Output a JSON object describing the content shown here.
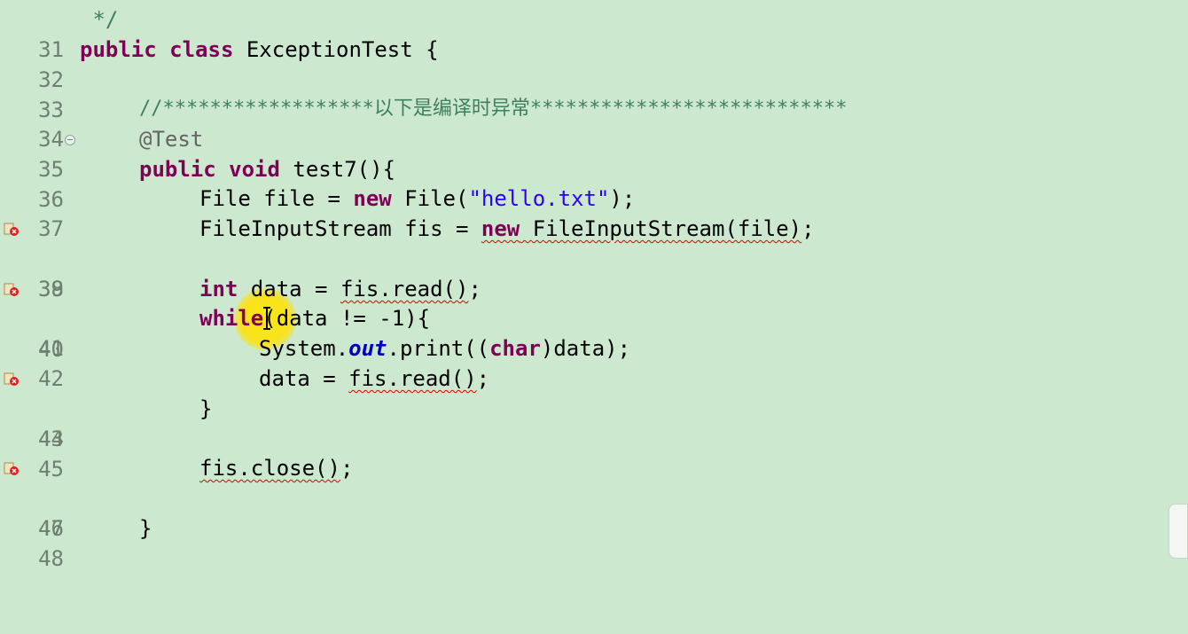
{
  "editor": {
    "lines": [
      {
        "n": "31",
        "code": " */"
      },
      {
        "n": "32",
        "code": "public class ExceptionTest {"
      },
      {
        "n": "33",
        "code": ""
      },
      {
        "n": "34",
        "code": "    //******************以下是编译时异常***************************"
      },
      {
        "n": "35",
        "code": "    @Test"
      },
      {
        "n": "36",
        "code": "    public void test7(){"
      },
      {
        "n": "37",
        "code": "        File file = new File(\"hello.txt\");"
      },
      {
        "n": "38",
        "code": "        FileInputStream fis = new FileInputStream(file);"
      },
      {
        "n": "39",
        "code": ""
      },
      {
        "n": "40",
        "code": "        int data = fis.read();"
      },
      {
        "n": "41",
        "code": "        while(data != -1){"
      },
      {
        "n": "42",
        "code": "            System.out.print((char)data);"
      },
      {
        "n": "43",
        "code": "            data = fis.read();"
      },
      {
        "n": "44",
        "code": "        }"
      },
      {
        "n": "45",
        "code": ""
      },
      {
        "n": "46",
        "code": "        fis.close();"
      },
      {
        "n": "47",
        "code": ""
      },
      {
        "n": "48",
        "code": "    }"
      }
    ],
    "error_lines": [
      "38",
      "40",
      "43",
      "46"
    ],
    "fold_line": "35"
  },
  "tokens": {
    "l31": " */",
    "public": "public",
    "class": "class",
    "classname": " ExceptionTest {",
    "comment34": "//******************以下是编译时异常***************************",
    "ann35": "@Test",
    "l36_public": "public",
    "l36_void": "void",
    "l36_rest": " test7(){",
    "l37_a": "File file = ",
    "l37_new": "new",
    "l37_b": " File(",
    "l37_str": "\"hello.txt\"",
    "l37_c": ");",
    "l38_a": "FileInputStream fis = ",
    "l38_new": "new",
    "l38_err": " FileInputStream(file)",
    "l38_c": ";",
    "l40_int": "int",
    "l40_a": " data = ",
    "l40_err": "fis.read()",
    "l40_c": ";",
    "l41_while": "while",
    "l41_rest": "(data != -1){",
    "l42_a": "System.",
    "l42_out": "out",
    "l42_b": ".print((",
    "l42_char": "char",
    "l42_c": ")data);",
    "l43_a": "data = ",
    "l43_err": "fis.read()",
    "l43_c": ";",
    "l44": "}",
    "l46_err": "fis.close()",
    "l46_c": ";",
    "l48": "}"
  },
  "colors": {
    "background": "#cce8cf",
    "keyword": "#7f0055",
    "comment": "#3f7f5f",
    "string": "#2a00ff",
    "annotation": "#646464",
    "static_field": "#0000c0",
    "error_underline": "#e00000",
    "line_number": "#6f7f72",
    "cursor_highlight": "#ffe800"
  },
  "icons": {
    "error_marker": "error-marker-icon",
    "fold": "fold-collapse-icon",
    "cursor": "ibeam-cursor-icon"
  }
}
